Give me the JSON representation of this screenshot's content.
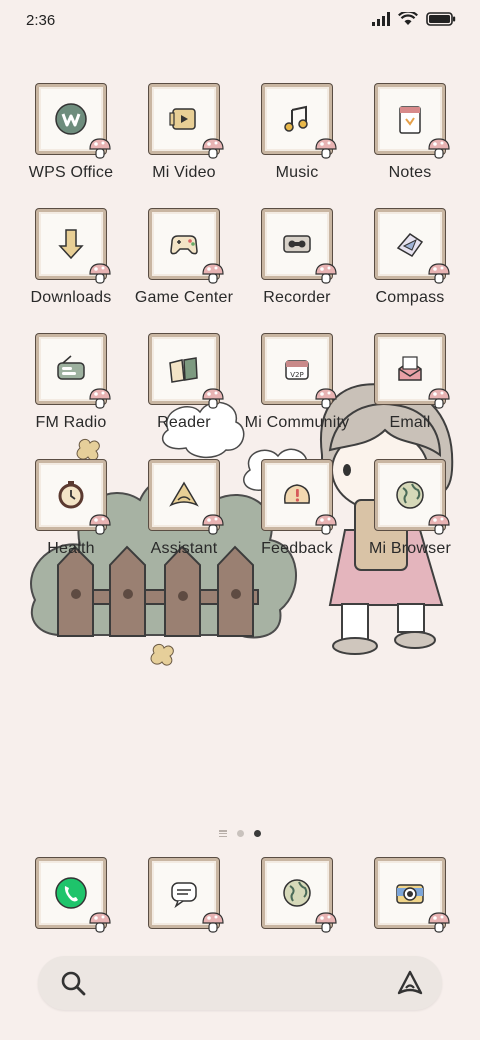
{
  "status": {
    "time": "2:36"
  },
  "apps": [
    {
      "label": "WPS Office",
      "icon": "wps-icon"
    },
    {
      "label": "Mi Video",
      "icon": "video-icon"
    },
    {
      "label": "Music",
      "icon": "music-icon"
    },
    {
      "label": "Notes",
      "icon": "notes-icon"
    },
    {
      "label": "Downloads",
      "icon": "download-icon"
    },
    {
      "label": "Game Center",
      "icon": "gamepad-icon"
    },
    {
      "label": "Recorder",
      "icon": "recorder-icon"
    },
    {
      "label": "Compass",
      "icon": "compass-icon"
    },
    {
      "label": "FM Radio",
      "icon": "radio-icon"
    },
    {
      "label": "Reader",
      "icon": "reader-icon"
    },
    {
      "label": "Mi Community",
      "icon": "community-icon"
    },
    {
      "label": "Email",
      "icon": "email-icon"
    },
    {
      "label": "Health",
      "icon": "health-icon"
    },
    {
      "label": "Assistant",
      "icon": "assistant-icon"
    },
    {
      "label": "Feedback",
      "icon": "feedback-icon"
    },
    {
      "label": "Mi Browser",
      "icon": "browser-icon"
    }
  ],
  "dock": [
    {
      "icon": "phone-icon"
    },
    {
      "icon": "messages-icon"
    },
    {
      "icon": "browser-icon"
    },
    {
      "icon": "camera-icon"
    }
  ],
  "pages": {
    "count": 2,
    "active": 2
  },
  "colors": {
    "background": "#f7efec",
    "frame": "#c9b6a2",
    "accent": "#2e8b57"
  }
}
